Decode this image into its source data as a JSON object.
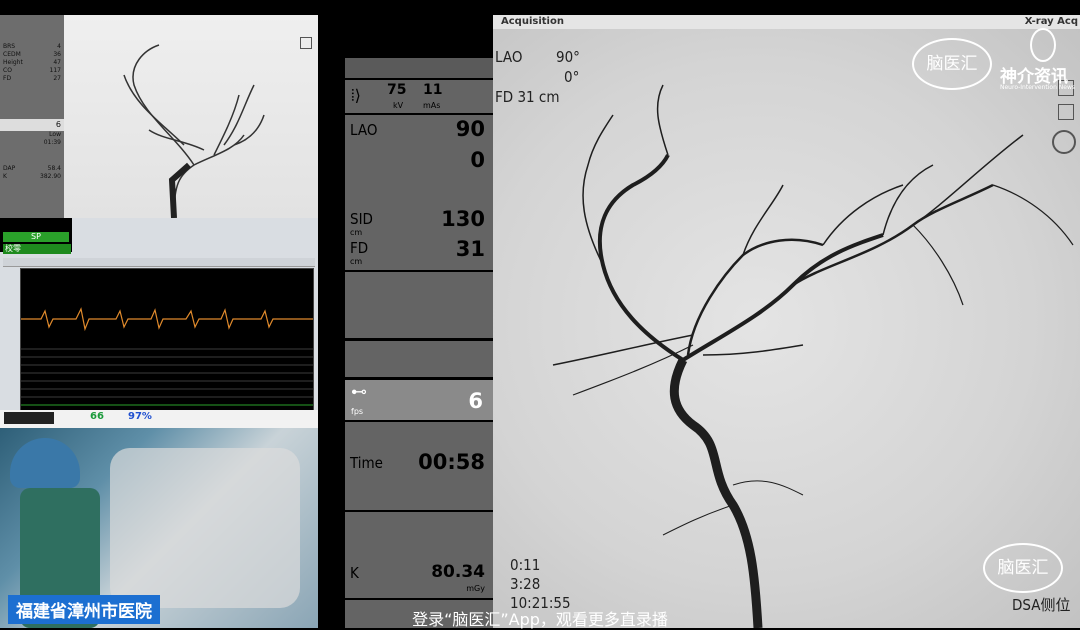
{
  "thumb": {
    "rows": [
      {
        "k": "BRS",
        "v": "4"
      },
      {
        "k": "CEDM",
        "v": "36"
      },
      {
        "k": "Height",
        "v": "47"
      },
      {
        "k": "CO",
        "v": "117"
      },
      {
        "k": "FD",
        "v": "27"
      }
    ],
    "num": "6",
    "low": "Low",
    "time": "01:39",
    "dap": "58.4",
    "k": "382.90"
  },
  "monitor": {
    "sp_label": "SP",
    "jiaoling": "校零",
    "hr": "66",
    "spo2": "97%"
  },
  "hospital": "福建省漳州市医院",
  "mid": {
    "kv": "75",
    "kv_unit": "kV",
    "mas": "11",
    "mas_unit": "mAs",
    "lao_label": "LAO",
    "lao_value": "90",
    "lao_value2": "0",
    "sid_label": "SID",
    "sid_unit": "cm",
    "sid_value": "130",
    "fd_label": "FD",
    "fd_unit": "cm",
    "fd_value": "31",
    "fps_unit": "fps",
    "fps_value": "6",
    "time_label": "Time",
    "time_value": "00:58",
    "k_label": "K",
    "k_value": "80.34",
    "k_unit": "mGy"
  },
  "xray": {
    "header_left": "Acquisition",
    "header_right": "X-ray Acq",
    "lao": "LAO",
    "lao_val": "90°",
    "lao_val2": "0°",
    "fd": "FD 31 cm",
    "t1": "0:11",
    "t2": "3:28",
    "t3": "10:21:55",
    "dsa": "DSA侧位",
    "wm_logo": "脑医汇",
    "wm_brand": "神介资讯",
    "wm_brand_sub": "Neuro-Intervention News"
  },
  "subtitle": "登录“脑医汇”App，观看更多直录播"
}
